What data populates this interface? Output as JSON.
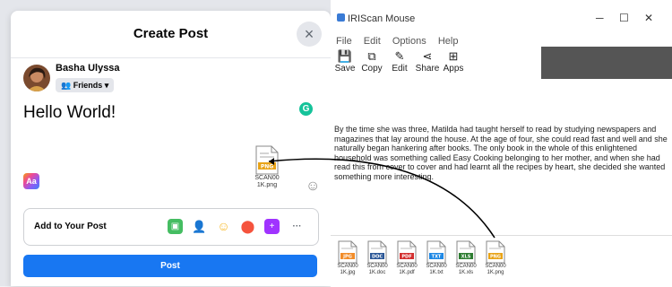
{
  "dialog": {
    "title": "Create Post",
    "close_glyph": "×",
    "user_name": "Basha Ulyssa",
    "audience": "Friends ▾",
    "post_text": "Hello World!",
    "grammarly_badge": "G",
    "text_style_badge": "Aa",
    "attached_file_caption_line1": "SCAN00",
    "attached_file_caption_line2": "1K.png",
    "add_to_post": "Add to Your Post",
    "more_glyph": "···",
    "post_button": "Post",
    "colors": {
      "primary": "#1877f2",
      "photo": "#45bd62",
      "tag": "#1877f2",
      "feeling": "#f7b928",
      "checkin": "#f5533d",
      "gif": "#a033ff"
    }
  },
  "iris": {
    "title": "IRIScan Mouse",
    "window_controls": [
      "─",
      "☐",
      "✕"
    ],
    "menu": [
      "File",
      "Edit",
      "Options",
      "Help"
    ],
    "toolbar": [
      {
        "label": "Save",
        "icon": "save-icon"
      },
      {
        "label": "Copy",
        "icon": "copy-icon"
      },
      {
        "label": "Edit",
        "icon": "edit-icon"
      },
      {
        "label": "Share",
        "icon": "share-icon"
      },
      {
        "label": "Apps",
        "icon": "apps-icon"
      }
    ],
    "document_text": "By the time she was three, Matilda had taught herself to read by studying newspapers and magazines that lay around the house. At the age of four, she could read fast and well and she naturally began hankering after books. The only book in the whole of this enlightened household was something called Easy Cooking belonging to her mother, and when she had read this from cover to cover and had learnt all the recipes by heart, she decided she wanted something more interesting.",
    "thumbnails": [
      {
        "ext": "JPG",
        "color": "#f28c28",
        "cap1": "SCAN00",
        "cap2": "1K.jpg"
      },
      {
        "ext": "DOC",
        "color": "#2b5797",
        "cap1": "SCAN00",
        "cap2": "1K.doc"
      },
      {
        "ext": "PDF",
        "color": "#d32f2f",
        "cap1": "SCAN00",
        "cap2": "1K.pdf"
      },
      {
        "ext": "TXT",
        "color": "#1e88e5",
        "cap1": "SCAN00",
        "cap2": "1K.txt"
      },
      {
        "ext": "XLS",
        "color": "#2e7d32",
        "cap1": "SCAN00",
        "cap2": "1K.xls"
      },
      {
        "ext": "PNG",
        "color": "#e8a317",
        "cap1": "SCAN00",
        "cap2": "1K.png"
      }
    ]
  }
}
